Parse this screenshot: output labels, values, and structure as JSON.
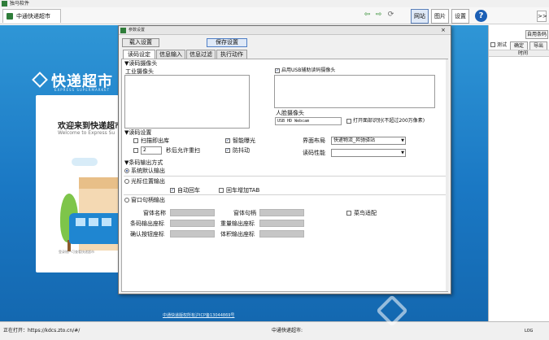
{
  "app": {
    "title": "独马软件"
  },
  "browser": {
    "tab_label": "中通快递超市",
    "toolbar_buttons": [
      "网站",
      "图片",
      "设置"
    ],
    "help_label": "?",
    "expand_label": ">>"
  },
  "background": {
    "logo": "快递超市",
    "logo_sub": "EXPRESS SUPERMARKET",
    "card_title": "欢迎来到快递超市",
    "card_sub": "Welcome to Express Su",
    "card_footer": "登录账户可查看快递超市",
    "footer_link": "中通快递版权所有沪ICP备13044869号"
  },
  "right_panel": {
    "btn_top": "自用条码",
    "check_label": "测试",
    "btn_confirm": "确定",
    "btn_export": "导出",
    "header_col": "时间"
  },
  "status": {
    "left": "正在打开：https://kdcs.zto.cn/#/",
    "middle": "中通快递超市:",
    "right": "LOG"
  },
  "dialog": {
    "title": "参数设置",
    "close": "×",
    "load_button": "载入设置",
    "save_button": "保存设置",
    "tabs": [
      "读码设定",
      "信息输入",
      "信息过滤",
      "执行动作"
    ],
    "sections": {
      "camera": "▼读码摄像头",
      "read_settings": "▼读码设置",
      "output_mode": "▼条码输出方式"
    },
    "camera": {
      "industrial_label": "工业摄像头",
      "usb_label": "启用USB辅助读码摄像头",
      "face_label": "人脸摄像头",
      "face_value": "USB HD Webcam",
      "face_checkbox": "打开面部识别(不超过200万像素)"
    },
    "read": {
      "scan_exit": "扫描即出库",
      "spin_value": "2",
      "spin_label": "秒后允许重扫",
      "smart_exposure": "智能曝光",
      "anti_shake": "防抖动",
      "layout_label": "界面布局",
      "layout_value": "快递物流_昇驰驿站",
      "perf_label": "读码性能",
      "perf_value": ""
    },
    "output": {
      "system_default": "系统默认输出",
      "cursor_pos": "光标位置输出",
      "auto_enter": "自动回车",
      "enter_tab": "回车增加TAB",
      "window_handle": "窗口句柄输出",
      "window_name": "窗体名称",
      "window_handle_lbl": "窗体句柄",
      "barcode_coord": "条码输出座标",
      "weight_coord": "重量输出座标",
      "confirm_coord": "确认按钮座标",
      "volume_coord": "体积输出座标",
      "cainiao": "菜鸟适配"
    }
  }
}
